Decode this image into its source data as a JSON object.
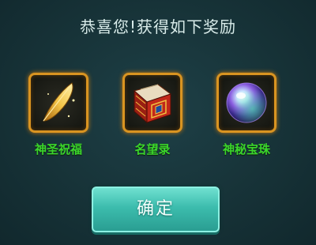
{
  "dialog": {
    "title": "恭喜您!获得如下奖励",
    "rewards": [
      {
        "name": "神圣祝福",
        "icon": "golden-feather-icon"
      },
      {
        "name": "名望录",
        "icon": "red-book-icon"
      },
      {
        "name": "神秘宝珠",
        "icon": "mystic-orb-icon"
      }
    ],
    "confirm_label": "确定"
  },
  "colors": {
    "background": "#163238",
    "title_text": "#d9ecea",
    "slot_border": "#d99421",
    "reward_label": "#3bd62b",
    "button": "#3cbcad"
  }
}
